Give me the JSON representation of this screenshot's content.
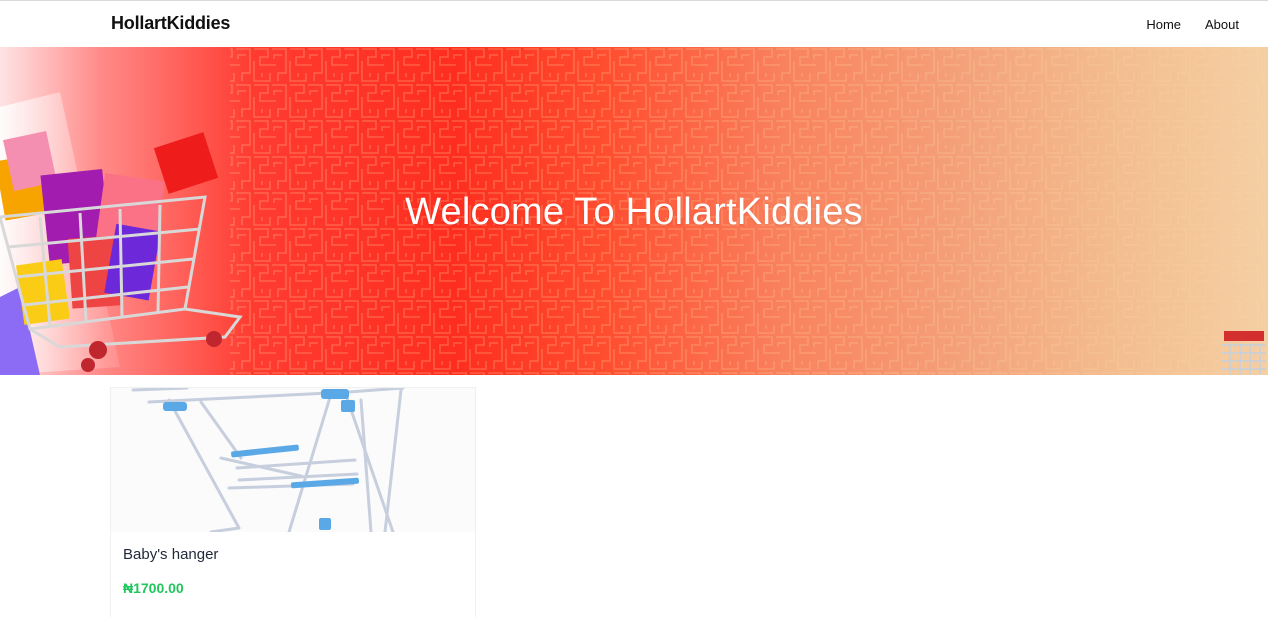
{
  "navbar": {
    "brand": "HollartKiddies",
    "links": [
      {
        "label": "Home"
      },
      {
        "label": "About"
      }
    ]
  },
  "hero": {
    "title": "Welcome To HollartKiddies",
    "colors": {
      "primary": "#ff3b30",
      "end": "#f4cfa4"
    },
    "images": [
      "shopping-cart-with-bags-illustration",
      "shopping-cart-illustration"
    ]
  },
  "products": [
    {
      "name": "Baby's hanger",
      "price": "₦1700.00",
      "image": "clothes-drying-rack-photo"
    }
  ],
  "colors": {
    "price": "#22c55e",
    "text": "#222a3a"
  }
}
